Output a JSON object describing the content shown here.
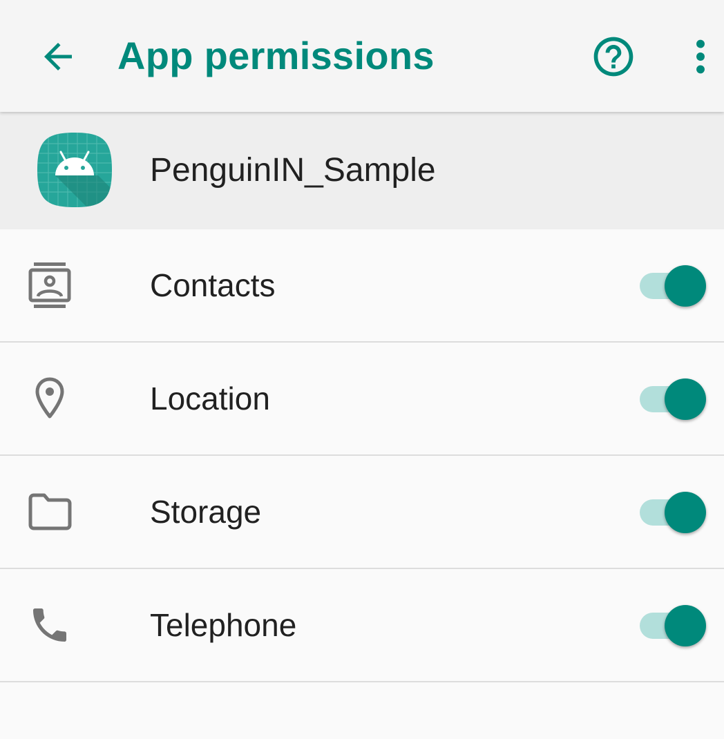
{
  "appbar": {
    "title": "App permissions",
    "back_icon": "arrow-back-icon",
    "help_icon": "help-circle-icon",
    "more_icon": "more-vert-icon",
    "accent_color": "#00897b"
  },
  "app": {
    "name": "PenguinIN_Sample",
    "icon": "android-app-icon"
  },
  "permissions": [
    {
      "label": "Contacts",
      "icon": "contacts-icon",
      "enabled": true
    },
    {
      "label": "Location",
      "icon": "location-pin-icon",
      "enabled": true
    },
    {
      "label": "Storage",
      "icon": "folder-icon",
      "enabled": true
    },
    {
      "label": "Telephone",
      "icon": "phone-icon",
      "enabled": true
    }
  ],
  "colors": {
    "switch_thumb": "#00897b",
    "switch_track": "#b2dfdb",
    "icon_gray": "#757575"
  }
}
